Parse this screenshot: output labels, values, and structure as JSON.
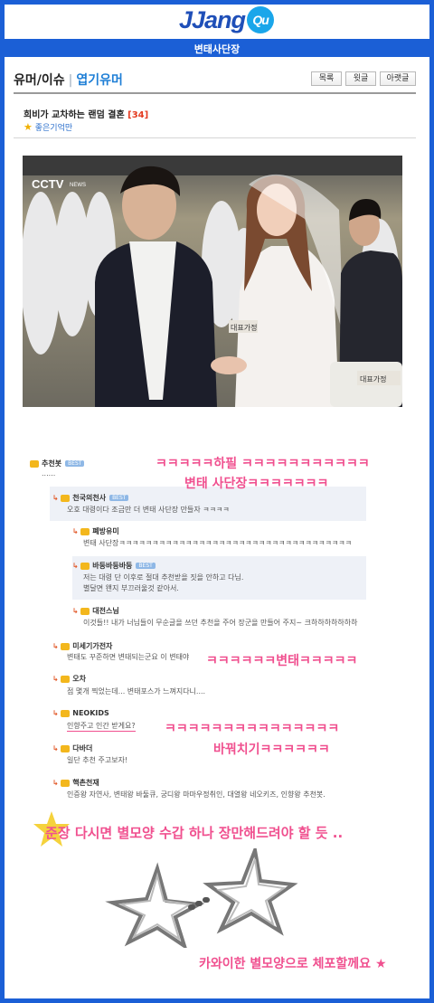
{
  "site": {
    "logo": "JJang",
    "logo_badge": "Qu",
    "board_name": "변태사단장"
  },
  "breadcrumb": {
    "section": "유머/이슈",
    "category": "엽기유머"
  },
  "toolbar": {
    "list": "목록",
    "prev": "윗글",
    "next": "아랫글"
  },
  "post": {
    "title": "희비가 교차하는 랜덤 결혼",
    "count": "[34]",
    "recommend_label": "좋은기억만"
  },
  "photo": {
    "broadcaster": "CCTV",
    "broadcaster_sub": "NEWS",
    "sign_1": "대표가정",
    "sign_2": "대표가정"
  },
  "comments": [
    {
      "author": "추천봇",
      "badge": "BEST",
      "text": "......"
    },
    {
      "author": "천국의천사",
      "badge": "BEST",
      "text": "오호 대령이다 조금만 더 변태 사단장 만들자 ㅋㅋㅋㅋ"
    },
    {
      "author": "폐방유미",
      "text": "변태 사단장ㅋㅋㅋㅋㅋㅋㅋㅋㅋㅋㅋㅋㅋㅋㅋㅋㅋㅋㅋㅋㅋㅋㅋㅋㅋㅋㅋㅋㅋㅋㅋㅋㅋㅋㅋ"
    },
    {
      "author": "바둥바둥바둥",
      "badge": "BEST",
      "text": "저는 대령 단 이후로 절대 추천받을 짓을 안하고 다님.",
      "text2": "별달면 왠지 부끄러울것 같아서."
    },
    {
      "author": "대전스님",
      "text": "이것들!! 내가 너님들이 무순글을 쓰던 추천을 주어 장군을 만들어 주지~ 크하하하하하하하"
    },
    {
      "author": "미세기가전자",
      "text": "변태도 꾸준하면 변태되는군요 이 변태야"
    },
    {
      "author": "오차",
      "text": "점 몇개 찍었는데... 변태포스가 느껴지다니...."
    },
    {
      "author": "NEOKIDS",
      "text": "인향주고 인간 받게요?"
    },
    {
      "author": "다바더",
      "text": "일단 추천 주고보자!"
    },
    {
      "author": "핵촌천재",
      "text": "인증왕 자연사, 변태왕 바둘큐, 궁디왕 마마우정취인, 대열왕 네오키즈, 인향왕 추천봇."
    }
  ],
  "overlays": {
    "o1": "ㅋㅋㅋㅋㅋ하필 ㅋㅋㅋㅋㅋㅋㅋㅋㅋㅋㅋ",
    "o2": "변태 사단장ㅋㅋㅋㅋㅋㅋㅋ",
    "o3": "ㅋㅋㅋㅋㅋㅋ변태ㅋㅋㅋㅋㅋ",
    "o4": "ㅋㅋㅋㅋㅋㅋㅋㅋㅋㅋㅋㅋㅋㅋㅋ",
    "o5": "바꿔치기ㅋㅋㅋㅋㅋㅋ",
    "caption1": "준장 다시면 별모양 수갑 하나 장만해드려야 할 듯 ..",
    "caption2": "카와이한 별모양으로 체포할께요 ★"
  },
  "colors": {
    "frame": "#1b5fd6",
    "accent_pink": "#f0508f",
    "link_blue": "#1f7fd6",
    "star_yellow": "#f5d23c"
  }
}
